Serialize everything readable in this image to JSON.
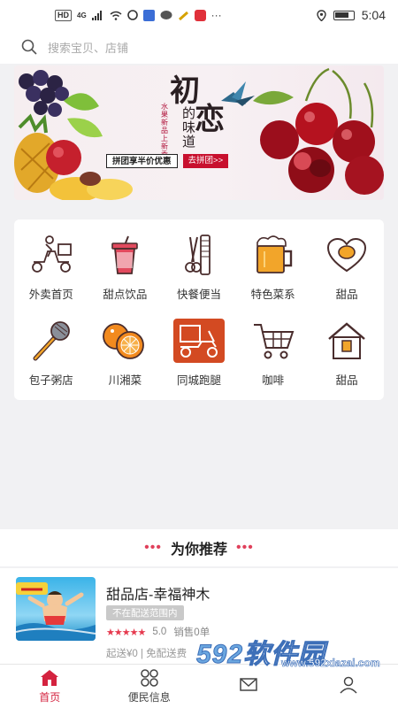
{
  "status_bar": {
    "left_badges": [
      "HD",
      "4G"
    ],
    "time": "5:04"
  },
  "search": {
    "placeholder": "搜索宝贝、店铺"
  },
  "banner": {
    "title_char_1": "初",
    "title_char_2": "恋",
    "title_side": "的味道",
    "title_tiny": "水果新品上新季",
    "promo_text": "拼团享半价优惠",
    "promo_button": "去拼团>>"
  },
  "categories": [
    {
      "label": "外卖首页",
      "icon": "delivery-scooter-icon"
    },
    {
      "label": "甜点饮品",
      "icon": "drink-cup-icon"
    },
    {
      "label": "快餐便当",
      "icon": "comb-scissors-icon"
    },
    {
      "label": "特色菜系",
      "icon": "beer-mug-icon"
    },
    {
      "label": "甜品",
      "icon": "egg-heart-icon"
    },
    {
      "label": "包子粥店",
      "icon": "microphone-icon"
    },
    {
      "label": "川湘菜",
      "icon": "oranges-icon"
    },
    {
      "label": "同城跑腿",
      "icon": "delivery-box-icon"
    },
    {
      "label": "咖啡",
      "icon": "shopping-cart-icon"
    },
    {
      "label": "甜品",
      "icon": "house-icon"
    }
  ],
  "recommend": {
    "title": "为你推荐",
    "dots_left": "•••",
    "dots_right": "•••"
  },
  "shop": {
    "name": "甜品店-幸福神木",
    "tag": "不在配送范围内",
    "stars": "★★★★★",
    "rating": "5.0",
    "sales": "销售0单",
    "delivery": "起送¥0 | 免配送费"
  },
  "tabs": [
    {
      "label": "首页",
      "icon": "home-icon",
      "active": true
    },
    {
      "label": "便民信息",
      "icon": "grid-icon",
      "active": false
    },
    {
      "label": "",
      "icon": "message-icon",
      "active": false
    },
    {
      "label": "",
      "icon": "user-icon",
      "active": false
    }
  ],
  "watermark": {
    "brand_num": "592",
    "brand_text": "软件园",
    "site": "www.592xiazai.com"
  },
  "colors": {
    "accent": "#d4233f",
    "banner_red": "#c8102e"
  }
}
